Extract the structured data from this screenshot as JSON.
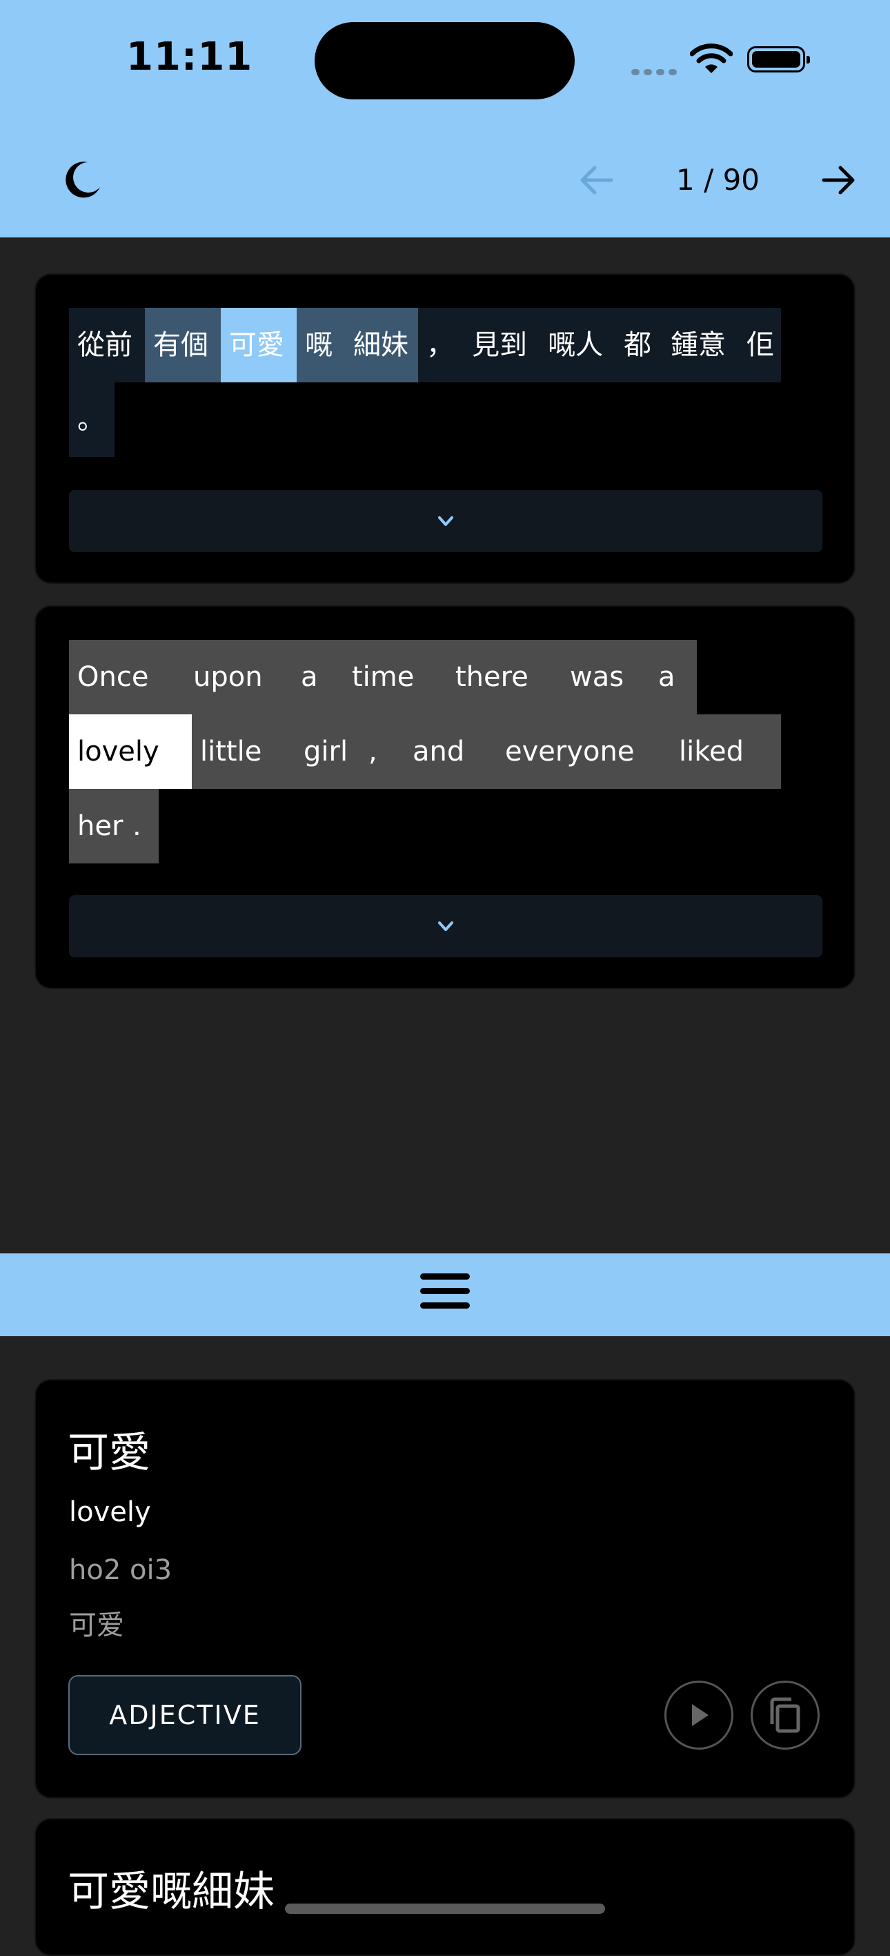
{
  "status_bar": {
    "time": "11:11"
  },
  "header": {
    "page_indicator": "1 / 90"
  },
  "source_sentence": {
    "tokens": [
      {
        "text": "從前",
        "state": "normal"
      },
      {
        "text": "有個",
        "state": "related"
      },
      {
        "text": "可愛",
        "state": "selected"
      },
      {
        "text": "嘅",
        "state": "related"
      },
      {
        "text": "細妹",
        "state": "related"
      },
      {
        "text": "，",
        "state": "normal"
      },
      {
        "text": "見到",
        "state": "normal"
      },
      {
        "text": "嘅人",
        "state": "normal"
      },
      {
        "text": "都",
        "state": "normal"
      },
      {
        "text": "鍾意",
        "state": "normal"
      },
      {
        "text": "佢",
        "state": "normal"
      },
      {
        "text": "。",
        "state": "normal"
      }
    ]
  },
  "translation_sentence": {
    "tokens": [
      {
        "text": "Once",
        "state": "normal"
      },
      {
        "text": "upon",
        "state": "normal"
      },
      {
        "text": "a",
        "state": "normal"
      },
      {
        "text": "time",
        "state": "normal"
      },
      {
        "text": "there",
        "state": "normal"
      },
      {
        "text": "was",
        "state": "normal"
      },
      {
        "text": "a",
        "state": "normal"
      },
      {
        "text": "lovely",
        "state": "selected"
      },
      {
        "text": "little",
        "state": "normal"
      },
      {
        "text": "girl",
        "state": "normal"
      },
      {
        "text": ",",
        "state": "normal"
      },
      {
        "text": "and",
        "state": "normal"
      },
      {
        "text": "everyone",
        "state": "normal"
      },
      {
        "text": "liked",
        "state": "normal"
      },
      {
        "text": "her",
        "state": "normal"
      },
      {
        "text": ".",
        "state": "normal"
      }
    ]
  },
  "definition": {
    "word": "可愛",
    "meaning": "lovely",
    "romanization": "ho2 oi3",
    "traditional": "可爱",
    "part_of_speech": "ADJECTIVE"
  },
  "next_definition": {
    "word": "可愛嘅細妹"
  },
  "colors": {
    "accent": "#90caf9",
    "source_normal": "#111b25",
    "source_related": "#3b5870",
    "source_selected": "#90caf9",
    "translation_normal": "#4c4c4c",
    "translation_selected": "#ffffff"
  },
  "icons": {
    "theme": "moon-icon",
    "prev": "arrow-left-icon",
    "next": "arrow-right-icon",
    "expand": "chevron-down-icon",
    "menu": "hamburger-icon",
    "play": "play-icon",
    "copy": "copy-icon"
  }
}
